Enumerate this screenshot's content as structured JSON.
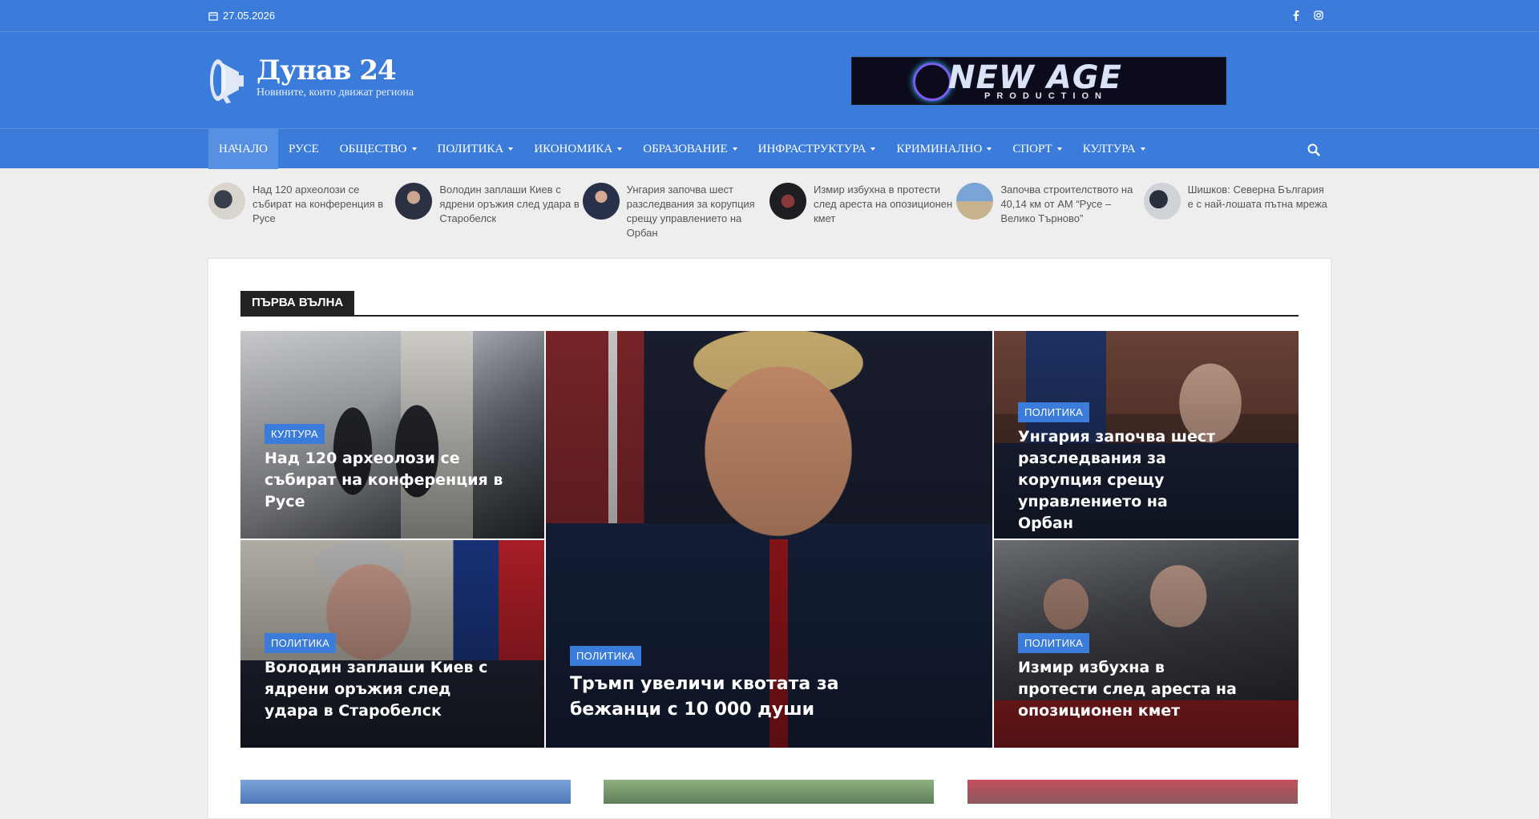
{
  "topbar": {
    "date": "27.05.2026",
    "date_icon": "calendar-icon",
    "social": [
      "facebook-icon",
      "instagram-icon"
    ]
  },
  "header": {
    "site_title": "Дунав 24",
    "tagline": "Новините, които движат региона",
    "banner_text": "NEW AGE",
    "banner_sub": "PRODUCTION"
  },
  "nav": {
    "items": [
      {
        "label": "НАЧАЛО",
        "dropdown": false,
        "active": true
      },
      {
        "label": "РУСЕ",
        "dropdown": false
      },
      {
        "label": "ОБЩЕСТВО",
        "dropdown": true
      },
      {
        "label": "ПОЛИТИКА",
        "dropdown": true
      },
      {
        "label": "ИКОНОМИКА",
        "dropdown": true
      },
      {
        "label": "ОБРАЗОВАНИЕ",
        "dropdown": true
      },
      {
        "label": "ИНФРАСТРУКТУРА",
        "dropdown": true
      },
      {
        "label": "КРИМИНАЛНО",
        "dropdown": true
      },
      {
        "label": "СПОРТ",
        "dropdown": true
      },
      {
        "label": "КУЛТУРА",
        "dropdown": true
      }
    ],
    "search_icon": "search-icon"
  },
  "ticker": [
    {
      "text": "Над 120 археолози се събират на конференция в Русе"
    },
    {
      "text": "Володин заплаши Киев с ядрени оръжия след удара в Старобелск"
    },
    {
      "text": "Унгария започва шест разследвания за корупция срещу управлението на Орбан"
    },
    {
      "text": "Измир избухна в протести след ареста на опозиционен кмет"
    },
    {
      "text": "Започва строителството на 40,14 км от АМ “Русе – Велико Търново”"
    },
    {
      "text": "Шишков: Северна България е с най-лошата пътна мрежа"
    }
  ],
  "section": {
    "title": "ПЪРВА ВЪЛНА"
  },
  "featured": [
    {
      "category": "КУЛТУРА",
      "headline": "Над 120 археолози се събират на конференция в Русе"
    },
    {
      "category": "ПОЛИТИКА",
      "headline": "Тръмп увеличи квотата за бежанци с 10 000 души"
    },
    {
      "category": "ПОЛИТИКА",
      "headline": "Унгария започва шест разследвания за корупция срещу управлението на Орбан"
    },
    {
      "category": "ПОЛИТИКА",
      "headline": "Володин заплаши Киев с ядрени оръжия след удара в Старобелск"
    },
    {
      "category": "ПОЛИТИКА",
      "headline": "Измир избухна в протести след ареста на опозиционен кмет"
    }
  ],
  "colors": {
    "brand_blue": "#3b7bd9",
    "section_dark": "#222222"
  }
}
